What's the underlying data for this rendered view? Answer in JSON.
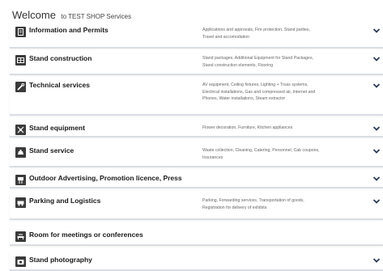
{
  "header": {
    "title": "Welcome",
    "subtitle": "to TEST SHOP Services"
  },
  "services": [
    {
      "title": "Information and Permits",
      "description": "Applications and approvals, Fire protection, Stand parties, Travel and accomodation",
      "icon": "permits-icon",
      "expandable": true
    },
    {
      "title": "Stand construction",
      "description": "Stand packages, Additional Equipment for Stand Packages, Stand construction elements, Flooring",
      "icon": "stand-construction-icon",
      "expandable": true
    },
    {
      "title": "Technical services",
      "description": "AV equipment, Ceiling fixtures, Lighting + Truss systems, Electrical installations, Gas and compressed air, Internet and Phones, Water installations, Steam extractor",
      "icon": "tools-icon",
      "expandable": true
    },
    {
      "title": "Stand equipment",
      "description": "Flower decoration, Furniture, Kitchen appliances",
      "icon": "equipment-icon",
      "expandable": true
    },
    {
      "title": "Stand service",
      "description": "Waste collection, Cleaning, Catering, Personnel, Cab coupons, Insurances",
      "icon": "service-icon",
      "expandable": true
    },
    {
      "title": "Outdoor Advertising, Promotion licence, Press",
      "description": "",
      "icon": "advertising-icon",
      "expandable": true
    },
    {
      "title": "Parking and Logistics",
      "description": "Parking, Forwarding services, Transportation of goods, Registration for delivery of exhibits",
      "icon": "parking-icon",
      "expandable": true
    },
    {
      "title": "Room for meetings or conferences",
      "description": "",
      "icon": "meeting-room-icon",
      "expandable": false
    },
    {
      "title": "Stand photography",
      "description": "",
      "icon": "camera-icon",
      "expandable": true
    }
  ]
}
